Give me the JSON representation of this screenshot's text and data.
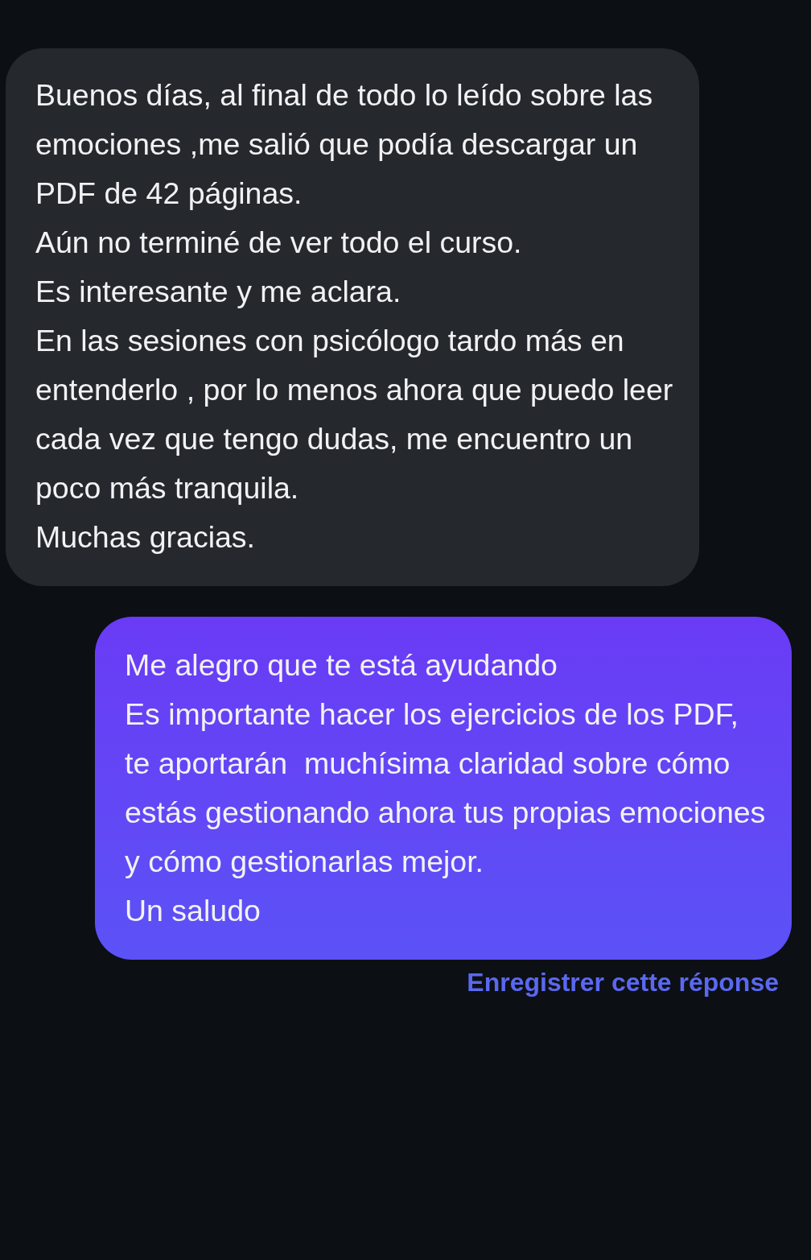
{
  "messages": [
    {
      "kind": "received",
      "paragraphs": [
        "Buenos días, al final de todo lo leído sobre las emociones ,me salió que podía descargar un PDF de 42 páginas.",
        "Aún no terminé de ver todo el curso.",
        "Es interesante y me aclara.",
        "En las sesiones con psicólogo tardo más en entenderlo , por lo menos ahora que puedo leer cada vez que tengo dudas, me encuentro un poco más tranquila.",
        "Muchas gracias."
      ]
    },
    {
      "kind": "sent",
      "paragraphs": [
        "Me alegro que te está ayudando",
        "Es importante hacer los ejercicios de los PDF, te aportarán  muchísima claridad sobre cómo estás gestionando ahora tus propias emociones y cómo gestionarlas mejor.",
        "Un saludo"
      ]
    }
  ],
  "save_link": "Enregistrer cette réponse"
}
